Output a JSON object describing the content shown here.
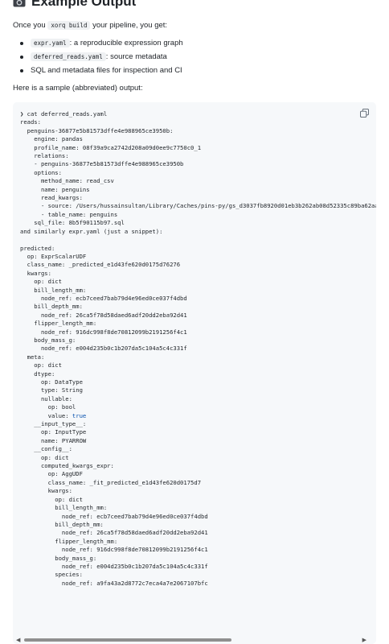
{
  "heading": {
    "title": "Example Output",
    "icon": "camera-icon"
  },
  "intro": {
    "prefix": "Once you",
    "command": "xorq build",
    "suffix": "your pipeline, you get:"
  },
  "outputs": [
    {
      "code": "expr.yaml",
      "description": ": a reproducible expression graph"
    },
    {
      "code": "deferred_reads.yaml",
      "description": ": source metadata"
    },
    {
      "code": "",
      "description": "SQL and metadata files for inspection and CI"
    }
  ],
  "sample_text": "Here is a sample (abbreviated) output:",
  "code_block": {
    "lines": [
      "❯ cat deferred_reads.yaml",
      "reads:",
      "  penguins-36877e5b81573dffe4e988965ce3950b:",
      "    engine: pandas",
      "    profile_name: 08f39a9ca2742d208a09d0ee9c7750c0_1",
      "    relations:",
      "    - penguins-36877e5b81573dffe4e988965ce3950b",
      "    options:",
      "      method_name: read_csv",
      "      name: penguins",
      "      read_kwargs:",
      "      - source: /Users/hussainsultan/Library/Caches/pins-py/gs_d3037fb8920d01eb3b262ab08d52335c89ba62aa/penguins",
      "      - table_name: penguins",
      "    sql_file: 8b5f90115b97.sql",
      "and similarly expr.yaml (just a snippet):",
      "",
      "predicted:",
      "  op: ExprScalarUDF",
      "  class_name: _predicted_e1d43fe620d0175d76276",
      "  kwargs:",
      "    op: dict",
      "    bill_length_mm:",
      "      node_ref: ecb7ceed7bab79d4e96ed0ce037f4dbd",
      "    bill_depth_mm:",
      "      node_ref: 26ca5f78d58daed6adf20dd2eba92d41",
      "    flipper_length_mm:",
      "      node_ref: 916dc998f8de70812099b2191256f4c1",
      "    body_mass_g:",
      "      node_ref: e004d235b0c1b207da5c104a5c4c331f",
      "  meta:",
      "    op: dict",
      "    dtype:",
      "      op: DataType",
      "      type: String",
      "      nullable:",
      "        op: bool",
      "        value: true",
      "    __input_type__:",
      "      op: InputType",
      "      name: PYARROW",
      "    __config__:",
      "      op: dict",
      "      computed_kwargs_expr:",
      "        op: AggUDF",
      "        class_name: _fit_predicted_e1d43fe620d0175d7",
      "        kwargs:",
      "          op: dict",
      "          bill_length_mm:",
      "            node_ref: ecb7ceed7bab79d4e96ed0ce037f4dbd",
      "          bill_depth_mm:",
      "            node_ref: 26ca5f78d58daed6adf20dd2eba92d41",
      "          flipper_length_mm:",
      "            node_ref: 916dc998f8de70812099b2191256f4c1",
      "          body_mass_g:",
      "            node_ref: e004d235b0c1b207da5c104a5c4c331f",
      "          species:",
      "            node_ref: a9fa43a2d8772c7eca4a7e2067107bfc"
    ]
  },
  "scrollbar": {
    "position": 0.0,
    "visible_fraction": 0.62
  },
  "colors": {
    "code_bg": "#f6f8fa",
    "text": "#1f2328",
    "literal_true": "#0550ae"
  }
}
